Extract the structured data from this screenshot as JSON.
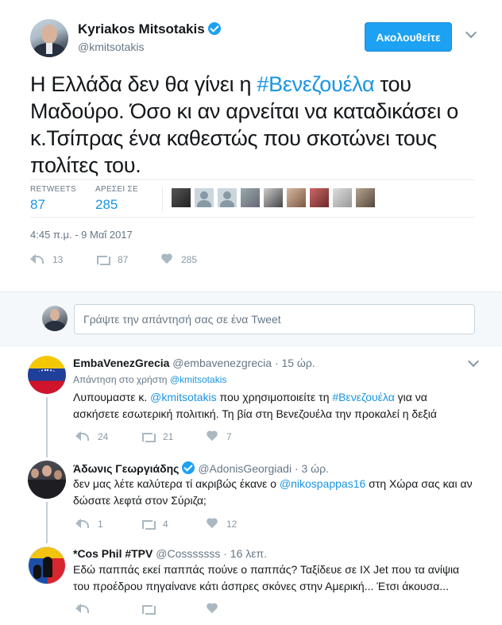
{
  "main": {
    "author": {
      "name": "Kyriakos Mitsotakis",
      "handle": "@kmitsotakis",
      "verified": true
    },
    "follow_label": "Ακολουθείτε",
    "text_parts": [
      "Η Ελλάδα δεν θα γίνει η ",
      "#Βενεζουέλα",
      " του Μαδούρο. Όσο κι αν αρνείται να καταδικάσει ο κ.Τσίπρας ένα καθεστώς που σκοτώνει τους πολίτες του."
    ],
    "stats": {
      "retweets_label": "RETWEETS",
      "retweets": "87",
      "likes_label": "ΑΡΕΣΕΙ ΣΕ",
      "likes": "285"
    },
    "timestamp": "4:45 π.μ. - 9 Μαΐ 2017",
    "actions": {
      "replies": "13",
      "retweets": "87",
      "likes": "285"
    }
  },
  "reply_box": {
    "placeholder": "Γράψτε την απάντησή σας σε ένα Tweet"
  },
  "replies": [
    {
      "name": "EmbaVenezGrecia",
      "handle": "@embavenezgrecia",
      "time": "· 15 ώρ.",
      "reply_to_prefix": "Απάντηση στο χρήστη",
      "reply_to": "@kmitsotakis",
      "text_parts": [
        "Λυπουμαστε κ. ",
        "@kmitsotakis",
        " που χρησιμοποιείτε τη ",
        "#Βενεζουέλα",
        " για να ασκήσετε εσωτερική πολιτική. Τη βία στη Βενεζουέλα την προκαλεί η δεξιά"
      ],
      "actions": {
        "replies": "24",
        "retweets": "21",
        "likes": "7"
      }
    },
    {
      "name": "Άδωνις Γεωργιάδης",
      "handle": "@AdonisGeorgiadi",
      "time": "· 3 ώρ.",
      "verified": true,
      "text_parts": [
        "δεν μας λέτε καλύτερα τί ακριβώς έκανε ο ",
        "@nikospappas16",
        " στη Χώρα σας και αν δώσατε λεφτά στον Σύριζα;"
      ],
      "actions": {
        "replies": "1",
        "retweets": "4",
        "likes": "12"
      }
    },
    {
      "name": "*Cos Phil #TPV",
      "handle": "@Cosssssss",
      "time": "· 16 λεπ.",
      "text": "Εδώ παππάς εκεί παππάς πούνε ο παππάς? Ταξίδευε σε ΙΧ Jet που τα ανίψια του προέδρου πηγαίνανε κάτι άσπρες σκόνες στην Αμερική... Έτσι άκουσα...",
      "actions": {
        "replies": "",
        "retweets": "",
        "likes": ""
      }
    }
  ],
  "colors": {
    "link": "#1b95e0",
    "button": "#1da1f2",
    "muted": "#657786"
  }
}
